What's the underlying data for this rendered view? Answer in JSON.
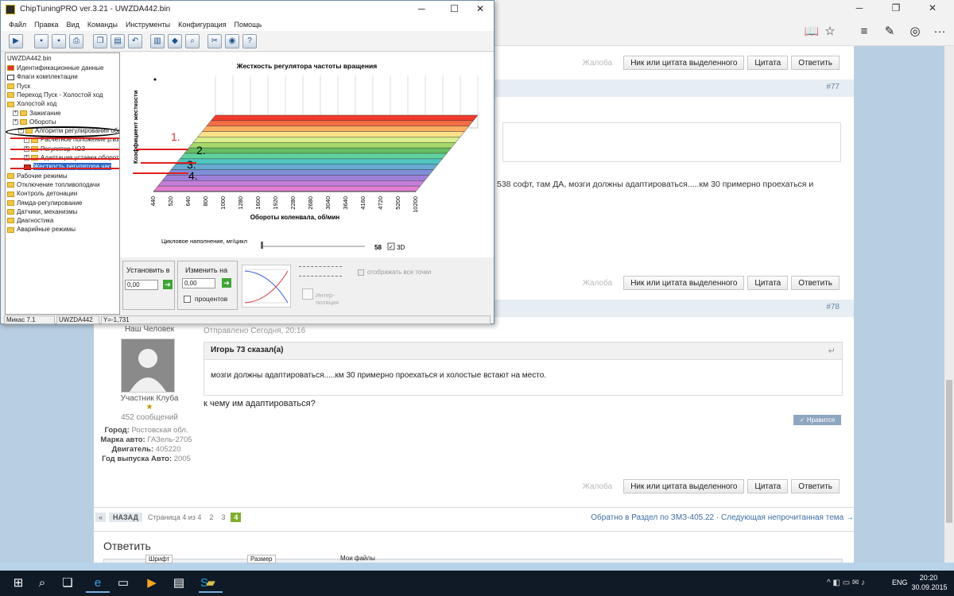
{
  "app": {
    "title": "ChipTuningPRO ver.3.21 - UWZDA442.bin",
    "menu": [
      "Файл",
      "Правка",
      "Вид",
      "Команды",
      "Инструменты",
      "Конфигурация",
      "Помощь"
    ],
    "tree": {
      "root": "UWZDA442.bin",
      "items": [
        "Идентификационные данные",
        "Флаги комплектации",
        "Пуск",
        "Переход Пуск - Холостой ход",
        "Холостой ход",
        "Зажигание",
        "Обороты",
        "Алгоритм регулирования оборо",
        "Расчетное положение р.вз",
        "Регулятор ЧОЗ",
        "Адаптация уставки оборото",
        "Жесткость регулятора час",
        "Рабочие режимы",
        "Отключение топливоподачи",
        "Контроль детонации",
        "Лямда-регулирование",
        "Датчики, механизмы",
        "Диагностика",
        "Аварийные режимы"
      ]
    },
    "chart": {
      "title": "Жесткость регулятора частоты вращения",
      "ylabel": "Коэффициент жесткости",
      "xlabel": "Обороты коленвала, об/мин",
      "xticks": [
        "440",
        "520",
        "640",
        "800",
        "1000",
        "1280",
        "1600",
        "1920",
        "2280",
        "2680",
        "3040",
        "3640",
        "4160",
        "4720",
        "5200",
        "10200"
      ]
    },
    "annotations": [
      "1.",
      "2.",
      "3.",
      "4."
    ],
    "fill_label": "Цикловое наполнение, мг/цикл",
    "fill_value": "58",
    "mode_3d": "3D",
    "controls": {
      "set_label": "Установить в",
      "set_value": "0,00",
      "change_label": "Изменить на",
      "change_value": "0,00",
      "percent_label": "процентов",
      "interp_label": "Интер-поляция",
      "show_points_label": "отображать все точки"
    },
    "status": [
      "Микас 7.1",
      "UWZDA442",
      "Y=-1,731"
    ]
  },
  "forum": {
    "post76_tail": "538 софт, там ДА, мозги должны адаптироваться.....км 30 примерно проехаться и",
    "complaint": "Жалоба",
    "quote_nick": "Ник или цитата выделенного",
    "quote": "Цитата",
    "reply": "Ответить",
    "post77_num": "#77",
    "post78_num": "#78",
    "author": {
      "name": "Наш Человек",
      "rank": "Участник Клуба",
      "posts": "452 сообщений",
      "city_label": "Город:",
      "city": "Ростовская обл.",
      "car_label": "Марка авто:",
      "car": "ГАЗель-2705",
      "engine_label": "Двигатель:",
      "engine": "405220",
      "year_label": "Год выпуска Авто:",
      "year": "2005"
    },
    "post78": {
      "sent": "Отправлено Сегодня, 20:16",
      "quote_author": "Игорь 73 сказал(а)",
      "quote_text": "мозги должны адаптироваться.....км 30 примерно проехаться и холостые встают на место.",
      "body": "к чему им адаптироваться?",
      "like": "Нравится"
    },
    "pagination": {
      "back": "НАЗАД",
      "label": "Страница 4 из 4",
      "pages": [
        "2",
        "3",
        "4"
      ],
      "active": "4"
    },
    "nav_text": "Обратно в Раздел по ЗМЗ-405.22 · Следующая непрочитанная тема →",
    "reply_title": "Ответить",
    "editor": {
      "font": "Шрифт",
      "size": "Размер",
      "myfiles": "Мои файлы"
    }
  },
  "taskbar": {
    "lang": "ENG",
    "time": "20:20",
    "date": "30.09.2015"
  },
  "colors": {
    "accent": "#3d6ea3",
    "active_page": "#7fae2f",
    "window_border": "#6f8aa6"
  }
}
